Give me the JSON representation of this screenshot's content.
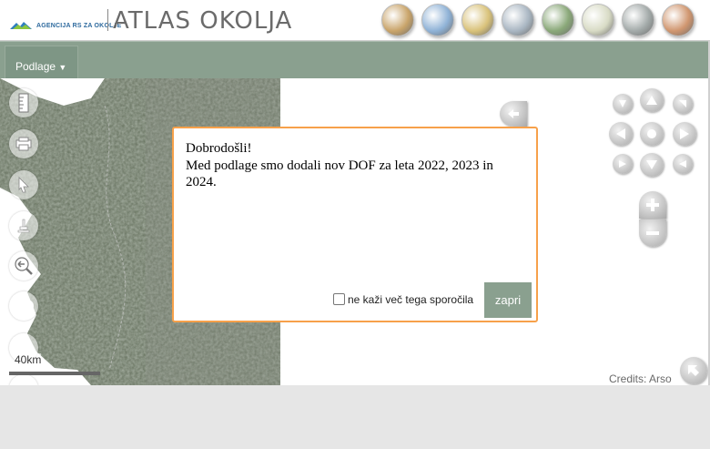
{
  "header": {
    "agency_name": "AGENCIJA RS ZA OKOLJE",
    "app_title": "ATLAS OKOLJA",
    "themes": [
      {
        "name": "theme-map-icon",
        "color": "#c9a46a"
      },
      {
        "name": "theme-air-icon",
        "color": "#8fb2d6"
      },
      {
        "name": "theme-fields-icon",
        "color": "#d9c27a"
      },
      {
        "name": "theme-water-icon",
        "color": "#a9b6c2"
      },
      {
        "name": "theme-nature-icon",
        "color": "#8aa879"
      },
      {
        "name": "theme-flower-icon",
        "color": "#d8dbc5"
      },
      {
        "name": "theme-lake-icon",
        "color": "#a3aaa9"
      },
      {
        "name": "theme-person-icon",
        "color": "#d0966f"
      }
    ]
  },
  "toolbar": {
    "basemap_label": "Podlage",
    "basemap_arrow": "▼"
  },
  "dialog": {
    "title": "Dobrodošli!",
    "body": "Med podlage smo dodali nov DOF za leta 2022, 2023 in 2024.",
    "checkbox_label": "ne kaži več tega sporočila",
    "close_label": "zapri"
  },
  "map": {
    "scale_label": "40km",
    "credits": "Credits: Arso"
  },
  "colors": {
    "toolbar": "#8aa08f",
    "dialog_border": "#f7a14a"
  }
}
